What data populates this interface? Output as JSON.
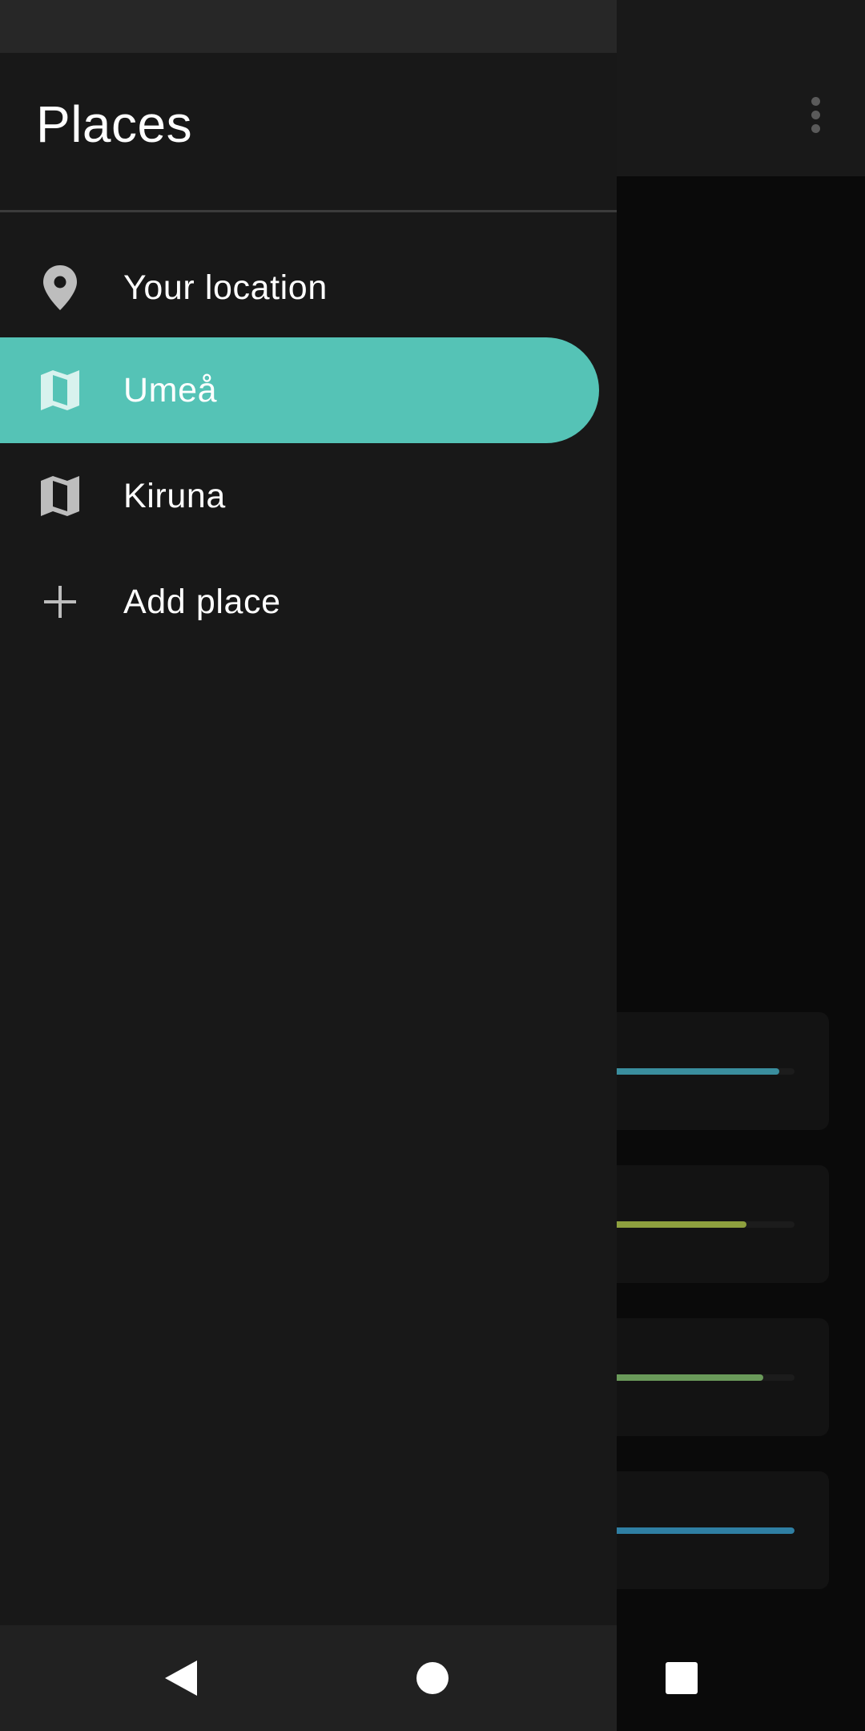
{
  "drawer": {
    "title": "Places",
    "items": [
      {
        "label": "Your location",
        "icon": "location-pin-icon",
        "selected": false
      },
      {
        "label": "Umeå",
        "icon": "map-icon",
        "selected": true
      },
      {
        "label": "Kiruna",
        "icon": "map-icon",
        "selected": false
      },
      {
        "label": "Add place",
        "icon": "plus-icon",
        "selected": false
      }
    ]
  },
  "background_cards": [
    {
      "progress": 0.92,
      "color": "#3a8e9e"
    },
    {
      "progress": 0.74,
      "color": "#8ea03e"
    },
    {
      "progress": 0.83,
      "color": "#6a9a5a"
    },
    {
      "progress": 1.0,
      "color": "#2f7fa3"
    }
  ],
  "colors": {
    "accent": "#55c3b6",
    "drawer_bg": "#181818",
    "status_bar": "#272727",
    "nav_bar": "#212121"
  },
  "system_nav": {
    "back_icon": "back-triangle-icon",
    "home_icon": "home-circle-icon",
    "recents_icon": "recents-square-icon"
  }
}
